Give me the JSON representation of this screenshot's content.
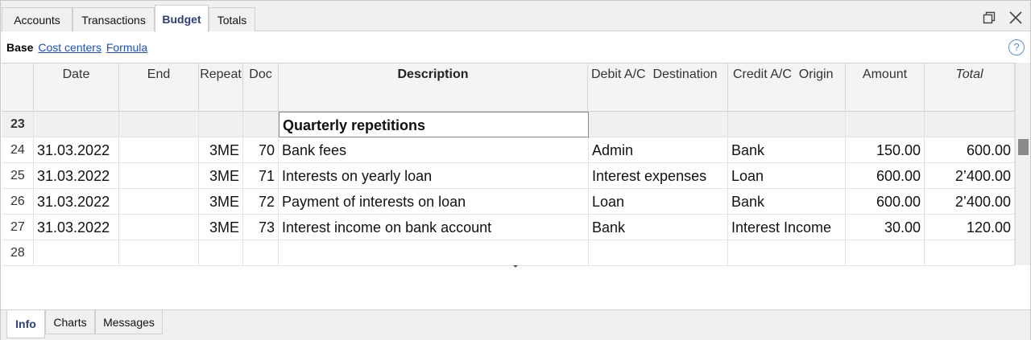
{
  "tabs": [
    {
      "label": "Accounts",
      "active": false
    },
    {
      "label": "Transactions",
      "active": false
    },
    {
      "label": "Budget",
      "active": true
    },
    {
      "label": "Totals",
      "active": false
    }
  ],
  "window_icons": [
    "restore-icon",
    "close-icon"
  ],
  "subnav": {
    "base": "Base",
    "links": [
      "Cost centers",
      "Formula"
    ],
    "help": "?"
  },
  "columns": [
    {
      "key": "rownum",
      "label": ""
    },
    {
      "key": "date",
      "label": "Date"
    },
    {
      "key": "end",
      "label": "End"
    },
    {
      "key": "repeat",
      "label": "Repeat"
    },
    {
      "key": "doc",
      "label": "Doc"
    },
    {
      "key": "description",
      "label": "Description"
    },
    {
      "key": "debit",
      "label": "Debit A/C  Destination"
    },
    {
      "key": "credit",
      "label": "Credit A/C  Origin"
    },
    {
      "key": "amount",
      "label": "Amount"
    },
    {
      "key": "total",
      "label": "Total"
    }
  ],
  "rows": [
    {
      "rownum": "23",
      "date": "",
      "end": "",
      "repeat": "",
      "doc": "",
      "description": "Quarterly repetitions",
      "debit": "",
      "credit": "",
      "amount": "",
      "total": ""
    },
    {
      "rownum": "24",
      "date": "31.03.2022",
      "end": "",
      "repeat": "3ME",
      "doc": "70",
      "description": "Bank fees",
      "debit": "Admin",
      "credit": "Bank",
      "amount": "150.00",
      "total": "600.00"
    },
    {
      "rownum": "25",
      "date": "31.03.2022",
      "end": "",
      "repeat": "3ME",
      "doc": "71",
      "description": "Interests on yearly loan",
      "debit": "Interest expenses",
      "credit": "Loan",
      "amount": "600.00",
      "total": "2’400.00"
    },
    {
      "rownum": "26",
      "date": "31.03.2022",
      "end": "",
      "repeat": "3ME",
      "doc": "72",
      "description": "Payment of interests on loan",
      "debit": "Loan",
      "credit": "Bank",
      "amount": "600.00",
      "total": "2’400.00"
    },
    {
      "rownum": "27",
      "date": "31.03.2022",
      "end": "",
      "repeat": "3ME",
      "doc": "73",
      "description": "Interest income on bank account",
      "debit": "Bank",
      "credit": "Interest Income",
      "amount": "30.00",
      "total": "120.00"
    },
    {
      "rownum": "28",
      "date": "",
      "end": "",
      "repeat": "",
      "doc": "",
      "description": "",
      "debit": "",
      "credit": "",
      "amount": "",
      "total": ""
    }
  ],
  "bottom_tabs": [
    {
      "label": "Info",
      "active": true
    },
    {
      "label": "Charts",
      "active": false
    },
    {
      "label": "Messages",
      "active": false
    }
  ]
}
